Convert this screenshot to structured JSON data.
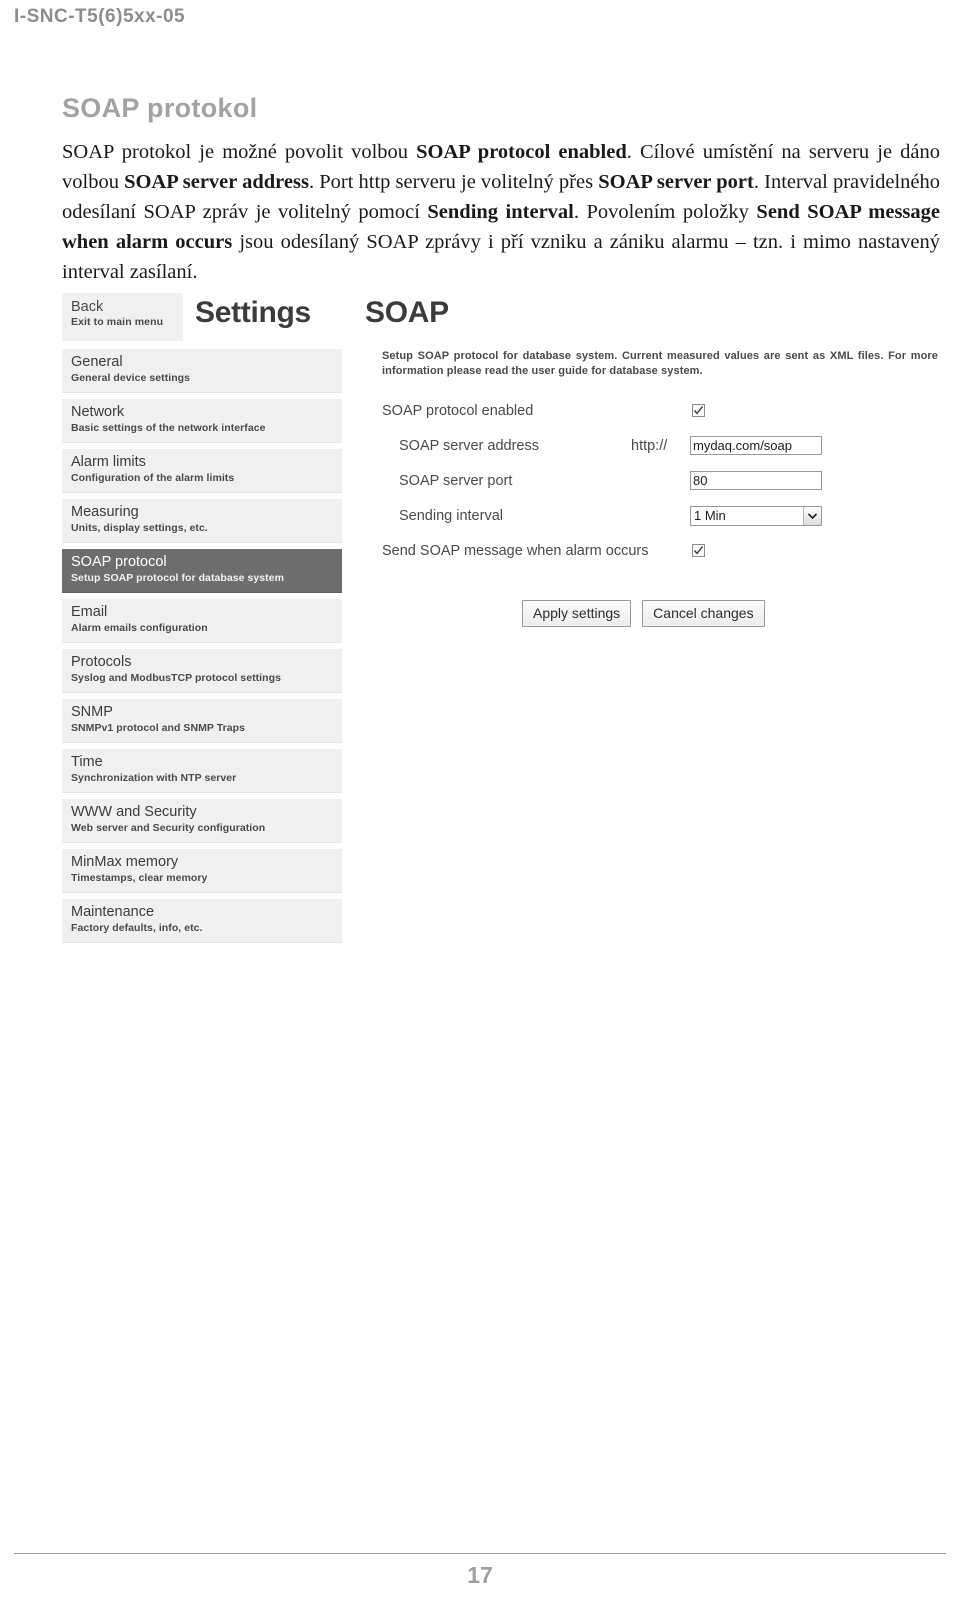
{
  "document": {
    "header_code": "I-SNC-T5(6)5xx-05",
    "section_title": "SOAP protokol",
    "page_number": "17",
    "body_paragraph": {
      "p1": "SOAP protokol je možné povolit volbou ",
      "b1": "SOAP protocol enabled",
      "p2": ". Cílové umístění na serveru je dáno volbou ",
      "b2": "SOAP server address",
      "p3": ". Port http serveru je volitelný přes ",
      "b3": "SOAP server port",
      "p4": ". Interval pravidelného odesílaní SOAP zpráv je volitelný pomocí ",
      "b4": "Sending interval",
      "p5": ". Povolením položky ",
      "b5": "Send SOAP message when alarm occurs",
      "p6": " jsou odesílaný SOAP zprávy i pří vzniku a zániku alarmu – tzn. i mimo nastavený interval zasílaní."
    }
  },
  "screenshot": {
    "back_button": {
      "title": "Back",
      "subtitle": "Exit to main menu"
    },
    "title": "Settings",
    "subtitle": "SOAP",
    "menu": [
      {
        "title": "General",
        "subtitle": "General device settings",
        "active": false
      },
      {
        "title": "Network",
        "subtitle": "Basic settings of the network interface",
        "active": false
      },
      {
        "title": "Alarm limits",
        "subtitle": "Configuration of the alarm limits",
        "active": false
      },
      {
        "title": "Measuring",
        "subtitle": "Units, display settings, etc.",
        "active": false
      },
      {
        "title": "SOAP protocol",
        "subtitle": "Setup SOAP protocol for database system",
        "active": true
      },
      {
        "title": "Email",
        "subtitle": "Alarm emails configuration",
        "active": false
      },
      {
        "title": "Protocols",
        "subtitle": "Syslog and ModbusTCP protocol settings",
        "active": false
      },
      {
        "title": "SNMP",
        "subtitle": "SNMPv1 protocol and SNMP Traps",
        "active": false
      },
      {
        "title": "Time",
        "subtitle": "Synchronization with NTP server",
        "active": false
      },
      {
        "title": "WWW and Security",
        "subtitle": "Web server and Security configuration",
        "active": false
      },
      {
        "title": "MinMax memory",
        "subtitle": "Timestamps, clear memory",
        "active": false
      },
      {
        "title": "Maintenance",
        "subtitle": "Factory defaults, info, etc.",
        "active": false
      }
    ],
    "description": "Setup SOAP protocol for database system. Current measured values are sent as XML files. For more information please read the user guide for database system.",
    "form": {
      "protocol_enabled_label": "SOAP protocol enabled",
      "protocol_enabled_checked": true,
      "server_address_label": "SOAP server address",
      "server_address_prefix": "http://",
      "server_address_value": "mydaq.com/soap",
      "server_port_label": "SOAP server port",
      "server_port_value": "80",
      "sending_interval_label": "Sending interval",
      "sending_interval_value": "1 Min",
      "sending_interval_options": [
        "1 Min"
      ],
      "alarm_message_label": "Send SOAP message when alarm occurs",
      "alarm_message_checked": true
    },
    "buttons": {
      "apply": "Apply settings",
      "cancel": "Cancel changes"
    }
  }
}
